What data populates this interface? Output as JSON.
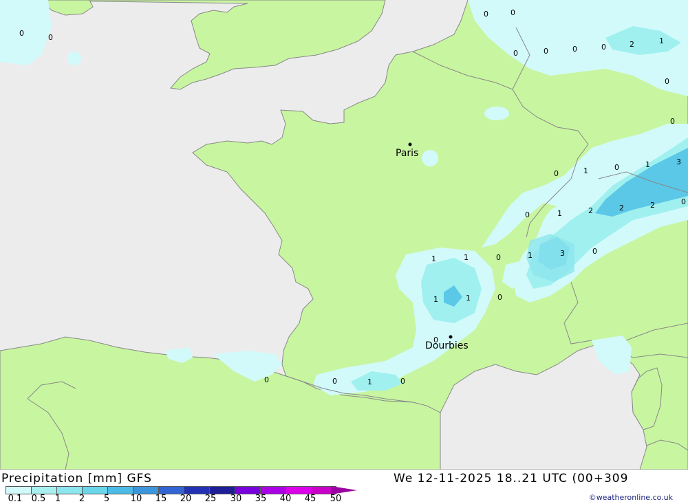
{
  "map": {
    "colors": {
      "sea": "#ececec",
      "land": "#c8f5a0",
      "precip_01": "#d2fafa",
      "precip_05": "#a0f0f0",
      "precip_1": "#8ce6ee",
      "precip_2": "#5ac8e6",
      "coast": "#888888"
    },
    "cities": [
      {
        "name": "Paris"
      },
      {
        "name": "Dourbies"
      }
    ],
    "contour_labels": [
      "0",
      "0",
      "0",
      "0",
      "0",
      "0",
      "0",
      "0",
      "2",
      "1",
      "0",
      "0",
      "0",
      "1",
      "0",
      "1",
      "3",
      "0",
      "1",
      "2",
      "2",
      "2",
      "0",
      "0",
      "1",
      "3",
      "0",
      "1",
      "1",
      "0",
      "1",
      "1",
      "0",
      "0",
      "0",
      "0",
      "1",
      "0"
    ]
  },
  "footer": {
    "title": "Precipitation [mm] GFS",
    "time": "We 12-11-2025 18..21 UTC (00+309",
    "credit": "©weatheronline.co.uk"
  },
  "legend": {
    "ticks": [
      "0.1",
      "0.5",
      "1",
      "2",
      "5",
      "10",
      "15",
      "20",
      "25",
      "30",
      "35",
      "40",
      "45",
      "50"
    ],
    "colors": [
      "#d2fafa",
      "#a8f0f0",
      "#8ce6ee",
      "#6ad6ea",
      "#4cbce6",
      "#3c96dc",
      "#3264d2",
      "#2332b4",
      "#1e1e96",
      "#7800dc",
      "#aa00e6",
      "#dc00ea",
      "#c800c8",
      "#a000a0"
    ]
  }
}
